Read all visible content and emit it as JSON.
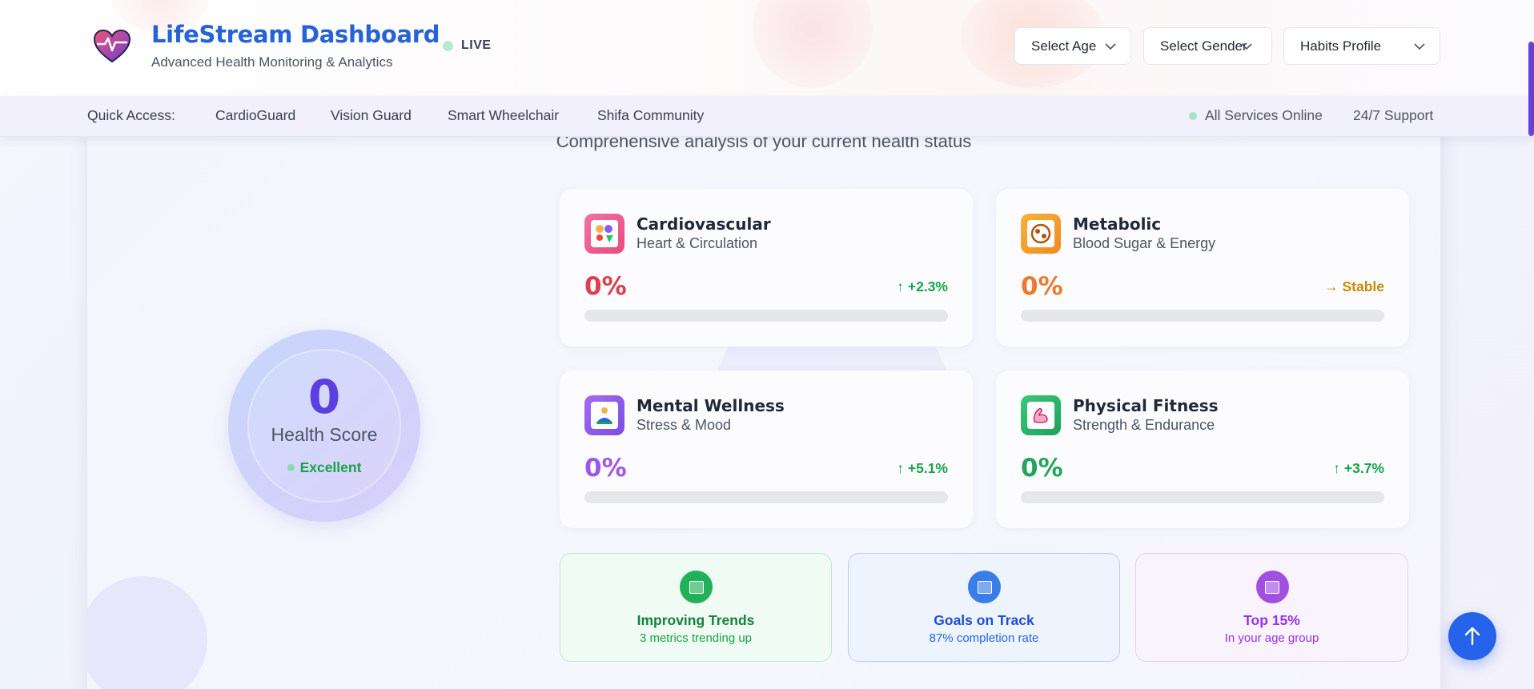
{
  "header": {
    "title": "LifeStream Dashboard",
    "subtitle": "Advanced Health Monitoring & Analytics",
    "live_label": "LIVE",
    "selects": {
      "age": "Select Age",
      "gender": "Select Gender",
      "habits": "Habits Profile"
    }
  },
  "quickbar": {
    "label": "Quick Access:",
    "links": [
      "CardioGuard",
      "Vision Guard",
      "Smart Wheelchair",
      "Shifa Community"
    ],
    "status": "All Services Online",
    "support": "24/7 Support"
  },
  "main": {
    "subtitle": "Comprehensive analysis of your current health status",
    "score": {
      "value": "0",
      "label": "Health Score",
      "status": "Excellent"
    },
    "metrics": [
      {
        "title": "Cardiovascular",
        "subtitle": "Heart & Circulation",
        "percent": "0%",
        "trend": "↑ +2.3%",
        "progress": 0,
        "icon": "heart-icon"
      },
      {
        "title": "Metabolic",
        "subtitle": "Blood Sugar & Energy",
        "percent": "0%",
        "trend": "→ Stable",
        "progress": 0,
        "icon": "metabolism-icon"
      },
      {
        "title": "Mental Wellness",
        "subtitle": "Stress & Mood",
        "percent": "0%",
        "trend": "↑ +5.1%",
        "progress": 0,
        "icon": "meditation-icon"
      },
      {
        "title": "Physical Fitness",
        "subtitle": "Strength & Endurance",
        "percent": "0%",
        "trend": "↑ +3.7%",
        "progress": 0,
        "icon": "muscle-icon"
      }
    ],
    "summary": [
      {
        "title": "Improving Trends",
        "subtitle": "3 metrics trending up"
      },
      {
        "title": "Goals on Track",
        "subtitle": "87% completion rate"
      },
      {
        "title": "Top 15%",
        "subtitle": "In your age group"
      }
    ]
  },
  "colors": {
    "brand": "#2563d6",
    "cardio": "#e03e4e",
    "metabolic": "#ea7a2e",
    "mental": "#9b59e6",
    "fitness": "#22a65a",
    "trend_up": "#16a34a",
    "trend_stable": "#ca8a04"
  }
}
